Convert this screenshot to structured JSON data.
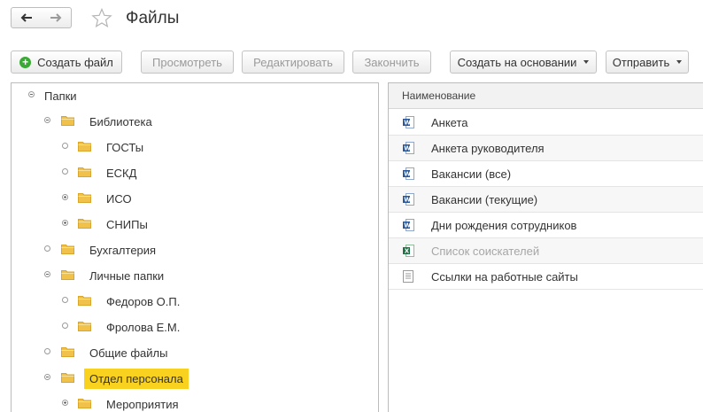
{
  "header": {
    "title": "Файлы"
  },
  "toolbar": {
    "create_file": "Создать файл",
    "view": "Просмотреть",
    "edit": "Редактировать",
    "finish": "Закончить",
    "create_based_on": "Создать на основании",
    "send": "Отправить"
  },
  "tree": {
    "items": [
      {
        "label": "Папки",
        "level": 0,
        "marker": "minus"
      },
      {
        "label": "Библиотека",
        "level": 1,
        "marker": "minus"
      },
      {
        "label": "ГОСТы",
        "level": 2,
        "marker": "none"
      },
      {
        "label": "ЕСКД",
        "level": 2,
        "marker": "none"
      },
      {
        "label": "ИСО",
        "level": 2,
        "marker": "plus"
      },
      {
        "label": "СНИПы",
        "level": 2,
        "marker": "plus"
      },
      {
        "label": "Бухгалтерия",
        "level": 1,
        "marker": "none"
      },
      {
        "label": "Личные папки",
        "level": 1,
        "marker": "minus"
      },
      {
        "label": "Федоров О.П.",
        "level": 2,
        "marker": "none"
      },
      {
        "label": "Фролова Е.М.",
        "level": 2,
        "marker": "none"
      },
      {
        "label": "Общие файлы",
        "level": 1,
        "marker": "none"
      },
      {
        "label": "Отдел персонала",
        "level": 1,
        "marker": "minus",
        "selected": true
      },
      {
        "label": "Мероприятия",
        "level": 2,
        "marker": "plus"
      }
    ]
  },
  "files": {
    "column_name": "Наименование",
    "rows": [
      {
        "name": "Анкета",
        "icon": "word-doc-icon",
        "dim": false
      },
      {
        "name": "Анкета руководителя",
        "icon": "word-doc-icon",
        "dim": false
      },
      {
        "name": "Вакансии (все)",
        "icon": "word-doc-icon",
        "dim": false
      },
      {
        "name": "Вакансии (текущие)",
        "icon": "word-doc-icon",
        "dim": false
      },
      {
        "name": "Дни рождения сотрудников",
        "icon": "word-doc-icon",
        "dim": false
      },
      {
        "name": "Список соискателей",
        "icon": "excel-doc-icon",
        "dim": true
      },
      {
        "name": "Ссылки на работные сайты",
        "icon": "text-doc-icon",
        "dim": false
      }
    ]
  },
  "colors": {
    "selection": "#f9d21f",
    "folder": "#f0c24b",
    "accent_green": "#3aaa35",
    "word_blue": "#2b5797",
    "excel_green": "#1e7145"
  }
}
